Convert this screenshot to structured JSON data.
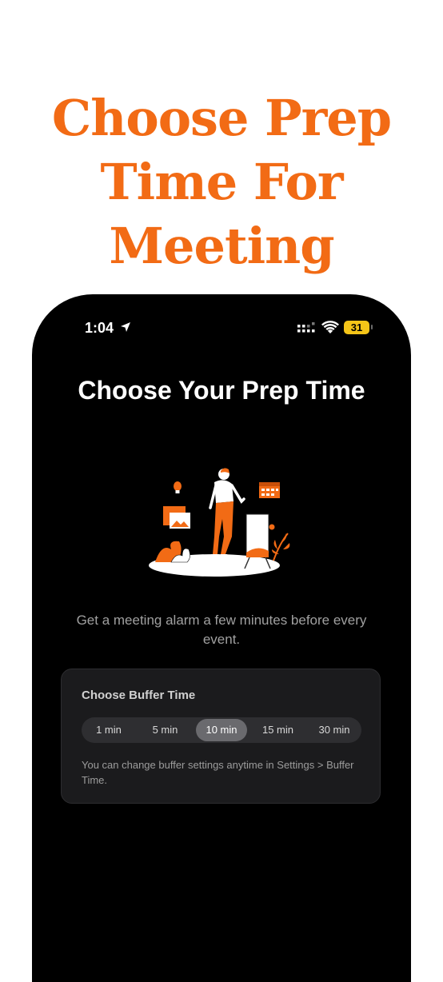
{
  "headline": [
    "Choose Prep",
    "Time For",
    "Meeting"
  ],
  "status_bar": {
    "time": "1:04",
    "battery": "31"
  },
  "screen": {
    "title": "Choose Your Prep Time",
    "description": "Get a meeting alarm a few minutes before every event."
  },
  "buffer_card": {
    "title": "Choose Buffer Time",
    "options": [
      "1 min",
      "5 min",
      "10 min",
      "15 min",
      "30 min"
    ],
    "selected": "10 min",
    "note": "You can change buffer settings anytime in Settings > Buffer Time."
  },
  "colors": {
    "accent": "#f26b15",
    "background": "#000000",
    "card": "#1b1b1d"
  },
  "icons": [
    "location-arrow-icon",
    "signal-icon",
    "wifi-icon",
    "battery-icon"
  ]
}
